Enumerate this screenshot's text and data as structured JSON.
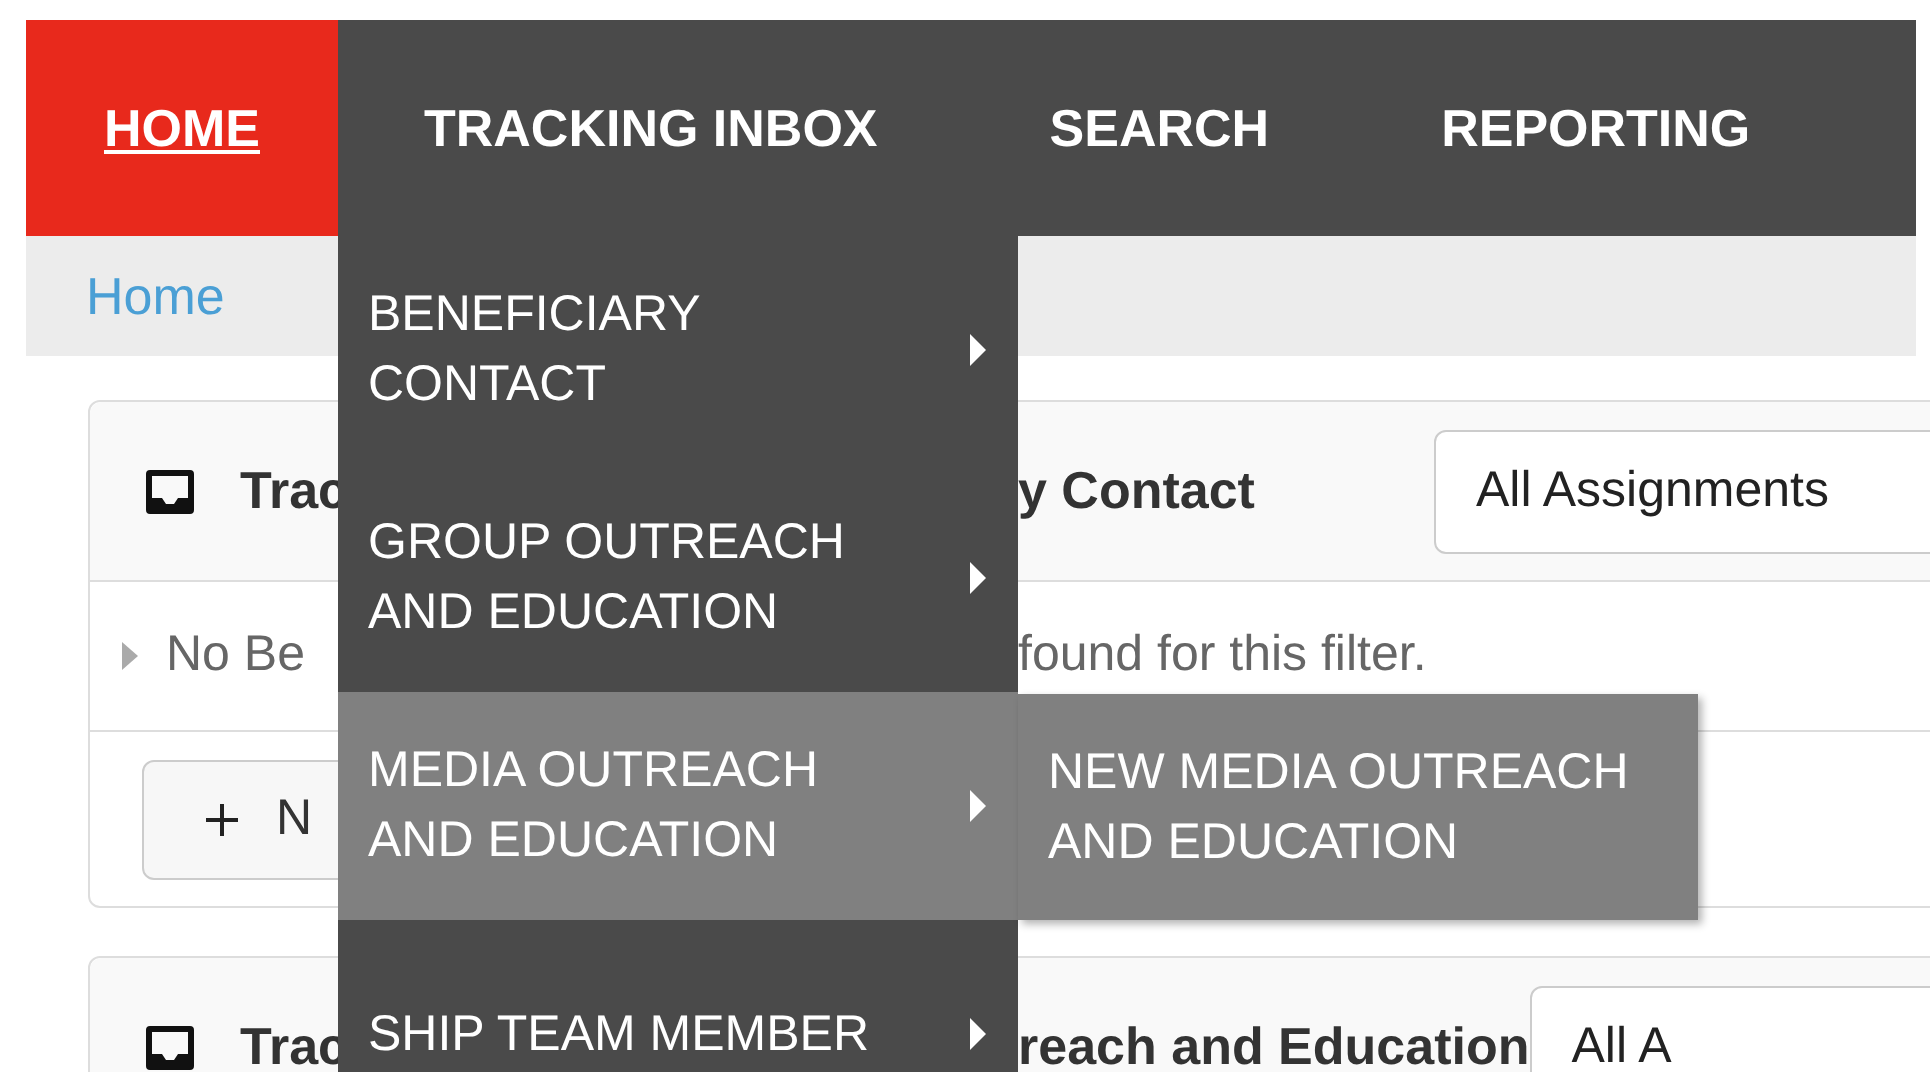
{
  "nav": {
    "items": [
      {
        "label": "HOME",
        "selected": true
      },
      {
        "label": "TRACKING INBOX",
        "selected": false
      },
      {
        "label": "SEARCH",
        "selected": false
      },
      {
        "label": "REPORTING",
        "selected": false
      }
    ]
  },
  "breadcrumb": [
    "Home"
  ],
  "dropdown": {
    "items": [
      {
        "label": "BENEFICIARY CONTACT",
        "selected": false
      },
      {
        "label": "GROUP OUTREACH AND EDUCATION",
        "selected": false
      },
      {
        "label": "MEDIA OUTREACH AND EDUCATION",
        "selected": true
      },
      {
        "label": "SHIP TEAM MEMBER",
        "selected": false
      }
    ]
  },
  "submenu": {
    "items": [
      {
        "label": "NEW MEDIA OUTREACH AND EDUCATION"
      }
    ]
  },
  "panels": [
    {
      "title_start": "Trac",
      "title_end": "y Contact",
      "filter": "All Assignments",
      "empty_start": "No Be",
      "empty_end": "found for this filter.",
      "button": "N"
    },
    {
      "title_start": "Trac",
      "title_end": "reach and Education",
      "filter": "All A"
    }
  ]
}
